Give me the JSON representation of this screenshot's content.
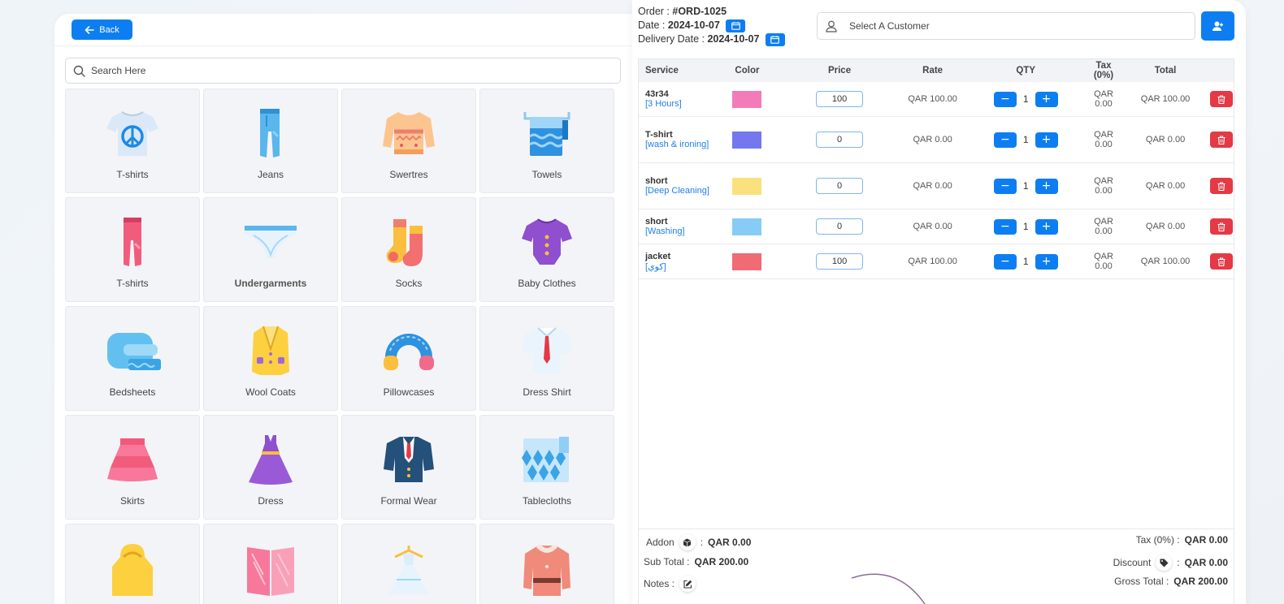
{
  "left": {
    "back_label": "Back",
    "search_placeholder": "Search Here",
    "categories": [
      {
        "label": "T-shirts",
        "icon": "tshirt-peace-icon"
      },
      {
        "label": "Jeans",
        "icon": "jeans-icon"
      },
      {
        "label": "Swertres",
        "icon": "sweater-icon"
      },
      {
        "label": "Towels",
        "icon": "towel-icon"
      },
      {
        "label": "T-shirts",
        "icon": "pants-icon"
      },
      {
        "label": "Undergarments",
        "icon": "underwear-icon"
      },
      {
        "label": "Socks",
        "icon": "socks-icon"
      },
      {
        "label": "Baby Clothes",
        "icon": "baby-onesie-icon"
      },
      {
        "label": "Bedsheets",
        "icon": "bedsheet-icon"
      },
      {
        "label": "Wool Coats",
        "icon": "wool-coat-icon"
      },
      {
        "label": "Pillowcases",
        "icon": "pillow-icon"
      },
      {
        "label": "Dress Shirt",
        "icon": "dress-shirt-icon"
      },
      {
        "label": "Skirts",
        "icon": "skirt-icon"
      },
      {
        "label": "Dress",
        "icon": "dress-icon"
      },
      {
        "label": "Formal Wear",
        "icon": "suit-icon"
      },
      {
        "label": "Tablecloths",
        "icon": "tablecloth-icon"
      },
      {
        "label": "",
        "icon": "raincoat-icon"
      },
      {
        "label": "",
        "icon": "curtain-icon"
      },
      {
        "label": "",
        "icon": "hanger-dress-icon"
      },
      {
        "label": "",
        "icon": "winter-coat-icon"
      }
    ]
  },
  "order": {
    "order_label": "Order : ",
    "order_no": "#ORD-1025",
    "date_label": "Date : ",
    "date": "2024-10-07",
    "delivery_label": "Delivery Date : ",
    "delivery_date": "2024-10-07",
    "customer_placeholder": "Select A Customer"
  },
  "table": {
    "headers": {
      "service": "Service",
      "color": "Color",
      "price": "Price",
      "rate": "Rate",
      "qty": "QTY",
      "tax": "Tax (0%)",
      "total": "Total"
    },
    "rows": [
      {
        "name": "43r34",
        "sub": "[3 Hours]",
        "color": "#f37cb8",
        "price": "100",
        "rate": "QAR 100.00",
        "qty": "1",
        "tax": "QAR 0.00",
        "total": "QAR 100.00"
      },
      {
        "name": "T-shirt",
        "sub": "[wash & ironing]",
        "color": "#7477ee",
        "price": "0",
        "rate": "QAR 0.00",
        "qty": "1",
        "tax": "QAR 0.00",
        "total": "QAR 0.00"
      },
      {
        "name": "short",
        "sub": "[Deep Cleaning]",
        "color": "#fbe17d",
        "price": "0",
        "rate": "QAR 0.00",
        "qty": "1",
        "tax": "QAR 0.00",
        "total": "QAR 0.00"
      },
      {
        "name": "short",
        "sub": "[Washing]",
        "color": "#86ccf6",
        "price": "0",
        "rate": "QAR 0.00",
        "qty": "1",
        "tax": "QAR 0.00",
        "total": "QAR 0.00"
      },
      {
        "name": "jacket",
        "sub": "[كوي]",
        "color": "#f06b73",
        "price": "100",
        "rate": "QAR 100.00",
        "qty": "1",
        "tax": "QAR 0.00",
        "total": "QAR 100.00"
      }
    ]
  },
  "summary": {
    "addon_label": "Addon",
    "addon_value": "QAR 0.00",
    "subtotal_label": "Sub Total :",
    "subtotal_value": "QAR 200.00",
    "notes_label": "Notes :",
    "tax_label": "Tax (0%) :",
    "tax_value": "QAR 0.00",
    "discount_label": "Discount",
    "discount_value": "QAR 0.00",
    "gross_label": "Gross Total :",
    "gross_value": "QAR 200.00"
  },
  "colors": {
    "accent": "#0d7ef2",
    "danger": "#e53945",
    "link": "#1e7fe6"
  }
}
